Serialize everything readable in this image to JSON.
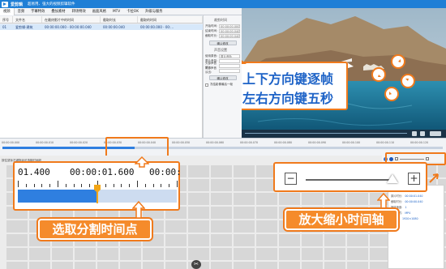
{
  "app": {
    "title": "爱剪辑",
    "subtitle": "超易用、强大的视频剪辑软件"
  },
  "menu": [
    "视频",
    "音频",
    "字幕特效",
    "叠加素材",
    "转场特效",
    "画面风格",
    "MTV",
    "卡拉OK",
    "升级与服务"
  ],
  "table": {
    "headers": [
      "序号",
      "文件名",
      "在最终影片中的时间",
      "截取时长",
      "截取的时间"
    ],
    "rows": [
      {
        "index": "01",
        "name": "爱剪辑-建筑",
        "time": "00:00:00.000 - 00:00:00.040",
        "duration": "00:00:00.040",
        "cut": "00:00:00.000 - 00:..."
      }
    ]
  },
  "params": {
    "section1": "裁剪时间",
    "start_label": "开始时间:",
    "start_value": "00:00:00.000",
    "end_label": "结束时间:",
    "end_value": "00:00:00.040",
    "dur_label": "截取时长:",
    "dur_value": "00:00:00.040",
    "apply_label": "确认修改",
    "section2": "声音设置",
    "audio_label": "使用原音:",
    "audio_value": "原片音轨",
    "vol_label": "原片音量:",
    "fade_in_label": "头部声音淡入:",
    "fade_out_label": "尾部声音淡出:",
    "apply2_label": "确认修改",
    "check_label": "冻结影像最后一帧"
  },
  "video_callout": {
    "line1": "上下方向键逐帧",
    "line2": "左右方向键五秒"
  },
  "ruler": [
    "00:00:00.000",
    "00:00:00.010",
    "00:00:00.020",
    "00:00:00.030",
    "00:00:00.040",
    "00:00:00.050",
    "00:00:00.060",
    "00:00:00.070",
    "00:00:00.080",
    "00:00:00.090",
    "00:00:00.100",
    "00:00:00.110",
    "00:00:00.120"
  ],
  "timeline": {
    "label": "按住鼠标左键拖动可选取时间段",
    "big_time_left": "01.400",
    "big_time_mid": "00:00:01.600",
    "big_time_right": "00:00:",
    "callout_cut": "选取分割时间点",
    "callout_zoom": "放大缩小时间轴",
    "zoom_progress": 0.88
  },
  "info": {
    "title": "所选视频信息",
    "lines": [
      "原片时长:",
      "截取时长:",
      "播放速度:",
      "视频格式:",
      "分辨率:"
    ],
    "values": [
      "00:00:01.040",
      "00:00:00.040",
      "1",
      "MP4",
      "1920×1080"
    ]
  },
  "colors": {
    "titlebar": "#1f7fd6",
    "callout": "#f07a1c",
    "callout_text": "#1e63c7",
    "timeline_blue": "#2f7fe0"
  }
}
